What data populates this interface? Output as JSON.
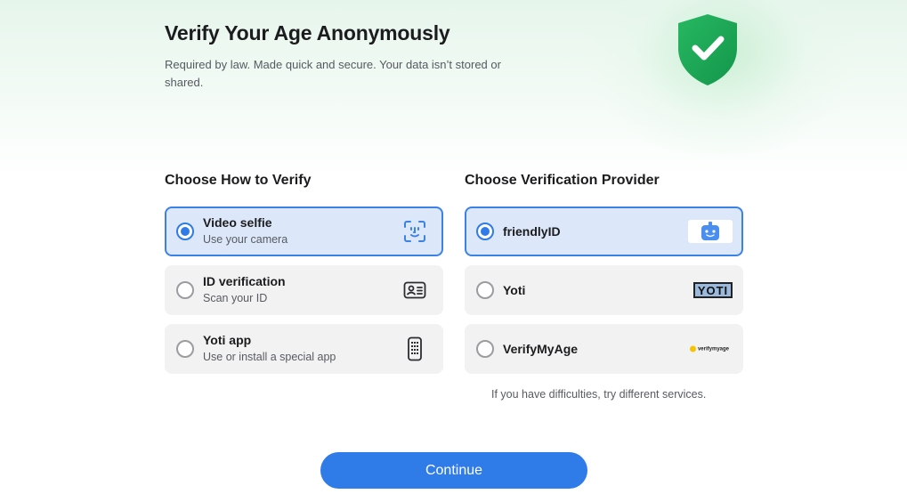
{
  "header": {
    "title": "Verify Your Age Anonymously",
    "subtitle": "Required by law. Made quick and secure. Your data isn’t stored or shared."
  },
  "methods": {
    "heading": "Choose How to Verify",
    "items": [
      {
        "label": "Video selfie",
        "sub": "Use your camera",
        "selected": true,
        "icon": "face-scan-icon"
      },
      {
        "label": "ID verification",
        "sub": "Scan your ID",
        "selected": false,
        "icon": "id-card-icon"
      },
      {
        "label": "Yoti app",
        "sub": "Use or install a special app",
        "selected": false,
        "icon": "phone-keypad-icon"
      }
    ]
  },
  "providers": {
    "heading": "Choose Verification Provider",
    "items": [
      {
        "label": "friendlyID",
        "selected": true,
        "logo": "friendlyid-logo"
      },
      {
        "label": "Yoti",
        "selected": false,
        "logo": "yoti-logo",
        "logo_text": "YOTI"
      },
      {
        "label": "VerifyMyAge",
        "selected": false,
        "logo": "verifymyage-logo",
        "logo_text": "verifymyage"
      }
    ],
    "hint": "If you have difficulties, try different services."
  },
  "continue_label": "Continue",
  "colors": {
    "accent": "#2f7be8",
    "shield": "#1fa855",
    "selected_bg": "#dce8f9"
  }
}
